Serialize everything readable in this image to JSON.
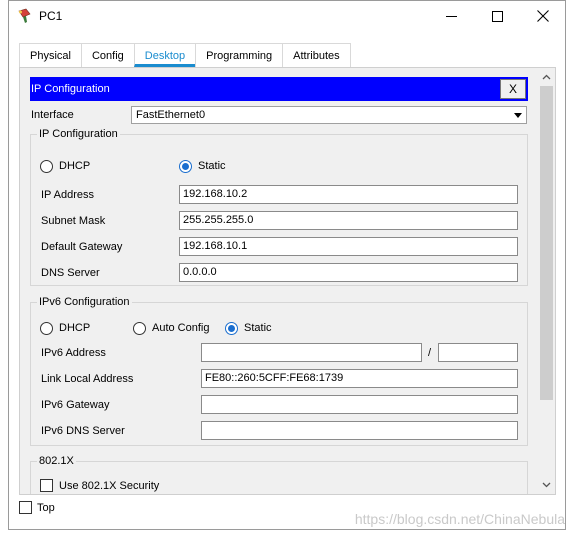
{
  "window": {
    "title": "PC1"
  },
  "tabs": [
    "Physical",
    "Config",
    "Desktop",
    "Programming",
    "Attributes"
  ],
  "active_tab": "Desktop",
  "ip_panel": {
    "header": "IP Configuration",
    "close_label": "X",
    "interface_label": "Interface",
    "interface_value": "FastEthernet0",
    "ipv4": {
      "group_title": "IP Configuration",
      "dhcp_label": "DHCP",
      "static_label": "Static",
      "selected": "Static",
      "ip_address_label": "IP Address",
      "ip_address": "192.168.10.2",
      "subnet_mask_label": "Subnet Mask",
      "subnet_mask": "255.255.255.0",
      "default_gateway_label": "Default Gateway",
      "default_gateway": "192.168.10.1",
      "dns_server_label": "DNS Server",
      "dns_server": "0.0.0.0"
    },
    "ipv6": {
      "group_title": "IPv6 Configuration",
      "dhcp_label": "DHCP",
      "auto_config_label": "Auto Config",
      "static_label": "Static",
      "selected": "Static",
      "ipv6_address_label": "IPv6 Address",
      "ipv6_address": "",
      "prefix_separator": "/",
      "prefix_length": "",
      "link_local_label": "Link Local Address",
      "link_local_address": "FE80::260:5CFF:FE68:1739",
      "ipv6_gateway_label": "IPv6 Gateway",
      "ipv6_gateway": "",
      "ipv6_dns_label": "IPv6 DNS Server",
      "ipv6_dns": ""
    },
    "dot1x": {
      "group_title": "802.1X",
      "use_security_label": "Use 802.1X Security"
    }
  },
  "footer": {
    "top_label": "Top"
  },
  "watermark": "https://blog.csdn.net/ChinaNebula",
  "colors": {
    "header_blue": "#0000ff",
    "tab_active": "#1a8ccf",
    "radio_on": "#1a6ecf"
  }
}
